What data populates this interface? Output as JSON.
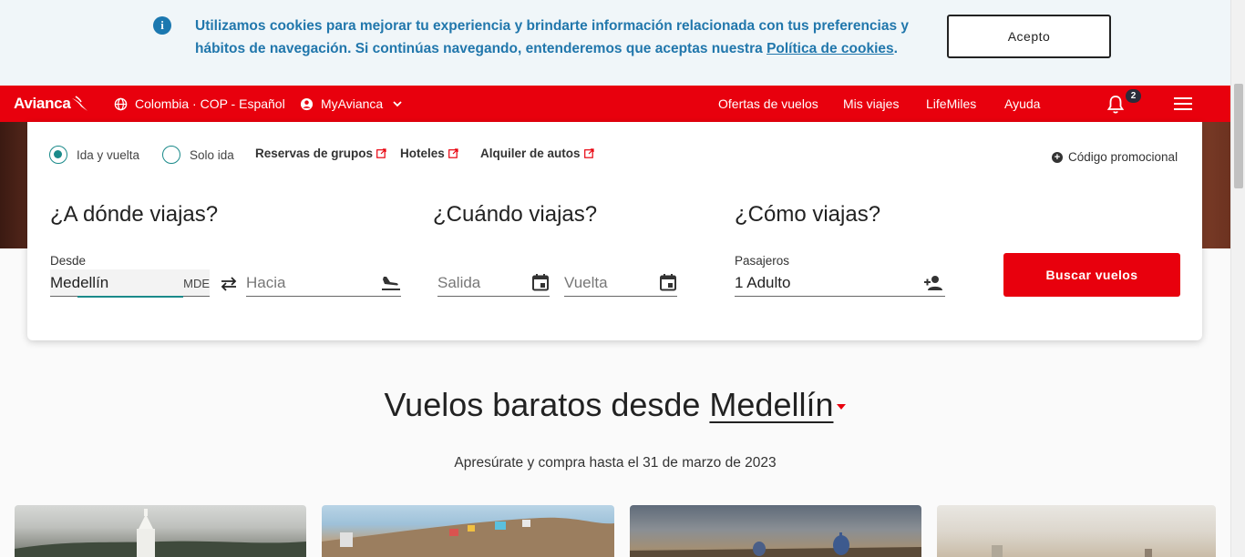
{
  "cookie_banner": {
    "text_part1": "Utilizamos cookies para mejorar tu experiencia y brindarte información relacionada con tus preferencias y hábitos de navegación. Si continúas navegando, entenderemos que aceptas nuestra ",
    "policy_link": "Política de cookies",
    "text_end": ".",
    "accept_label": "Acepto",
    "info_icon": "i"
  },
  "navbar": {
    "logo": "Avianca",
    "locale": "Colombia · COP - Español",
    "account": "MyAvianca",
    "links": [
      "Ofertas de vuelos",
      "Mis viajes",
      "LifeMiles",
      "Ayuda"
    ],
    "notification_count": "2",
    "brand_color": "#e8000d"
  },
  "search": {
    "trip_types": [
      "Ida y vuelta",
      "Solo ida"
    ],
    "selected_trip_type": "Ida y vuelta",
    "external_links": [
      "Reservas de grupos",
      "Hoteles",
      "Alquiler de autos"
    ],
    "promo_code": "Código promocional",
    "where_title": "¿A dónde viajas?",
    "when_title": "¿Cuándo viajas?",
    "how_title": "¿Cómo viajas?",
    "from_label": "Desde",
    "from_value": "Medellín",
    "from_code": "MDE",
    "to_placeholder": "Hacia",
    "departure_placeholder": "Salida",
    "return_placeholder": "Vuelta",
    "passengers_label": "Pasajeros",
    "passengers_value": "1 Adulto",
    "search_button": "Buscar vuelos"
  },
  "promo_section": {
    "headline_prefix": "Vuelos baratos desde ",
    "headline_city": "Medellín",
    "subline": "Apresúrate y compra hasta el 31 de marzo de 2023"
  }
}
